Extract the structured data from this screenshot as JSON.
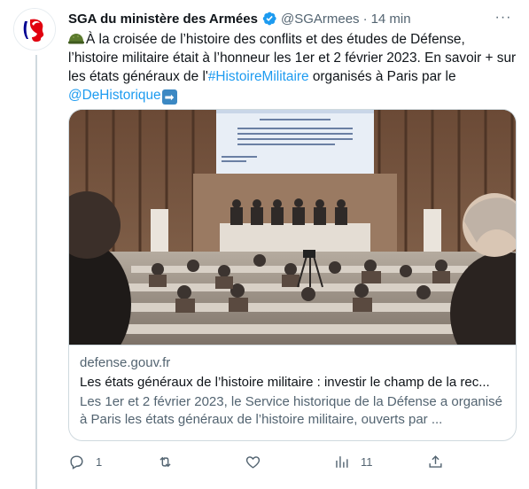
{
  "tweet": {
    "author_name": "SGA du ministère des Armées",
    "handle": "@SGArmees",
    "separator": "·",
    "time": "14 min",
    "more_label": "···",
    "text_part1": "À la croisée de l’histoire des conflits et des études de Défense, l’histoire militaire était à l’honneur les 1er et 2 février 2023. En savoir + sur les états généraux de l'",
    "hashtag": "#HistoireMilitaire",
    "text_part2": " organisés à Paris par le ",
    "mention": "@DeHistorique",
    "arrow_glyph": "➡"
  },
  "card": {
    "domain": "defense.gouv.fr",
    "title": "Les états généraux de l’histoire militaire : investir le champ de la rec...",
    "description": "Les 1er et 2 février 2023, le Service historique de la Défense a organisé à Paris les états généraux de l’histoire militaire, ouverts par ...",
    "slide_text": "Modération : G. Piketty (Sciences Po) · S. Audoin-Rouzeau (EHESS), H. Drévillon (Paris I - Panthéon Sorbonne), L. Capdetrey (Bordeaux Montaigne), S. Hilary (Sorbonne Université), LCL I. Cabees (SHD), J. de Praneuf (Lille - SHD)"
  },
  "actions": {
    "reply_count": "1",
    "retweet_count": "",
    "like_count": "",
    "views_count": "11"
  },
  "colors": {
    "accent": "#1d9bf0",
    "secondary_text": "#536471",
    "border": "#cfd9de",
    "verified": "#1d9bf0"
  },
  "icons": [
    "marianne-avatar",
    "verified-badge-icon",
    "more-icon",
    "military-helmet-emoji",
    "right-arrow-emoji",
    "reply-icon",
    "retweet-icon",
    "like-icon",
    "views-icon",
    "share-icon"
  ]
}
